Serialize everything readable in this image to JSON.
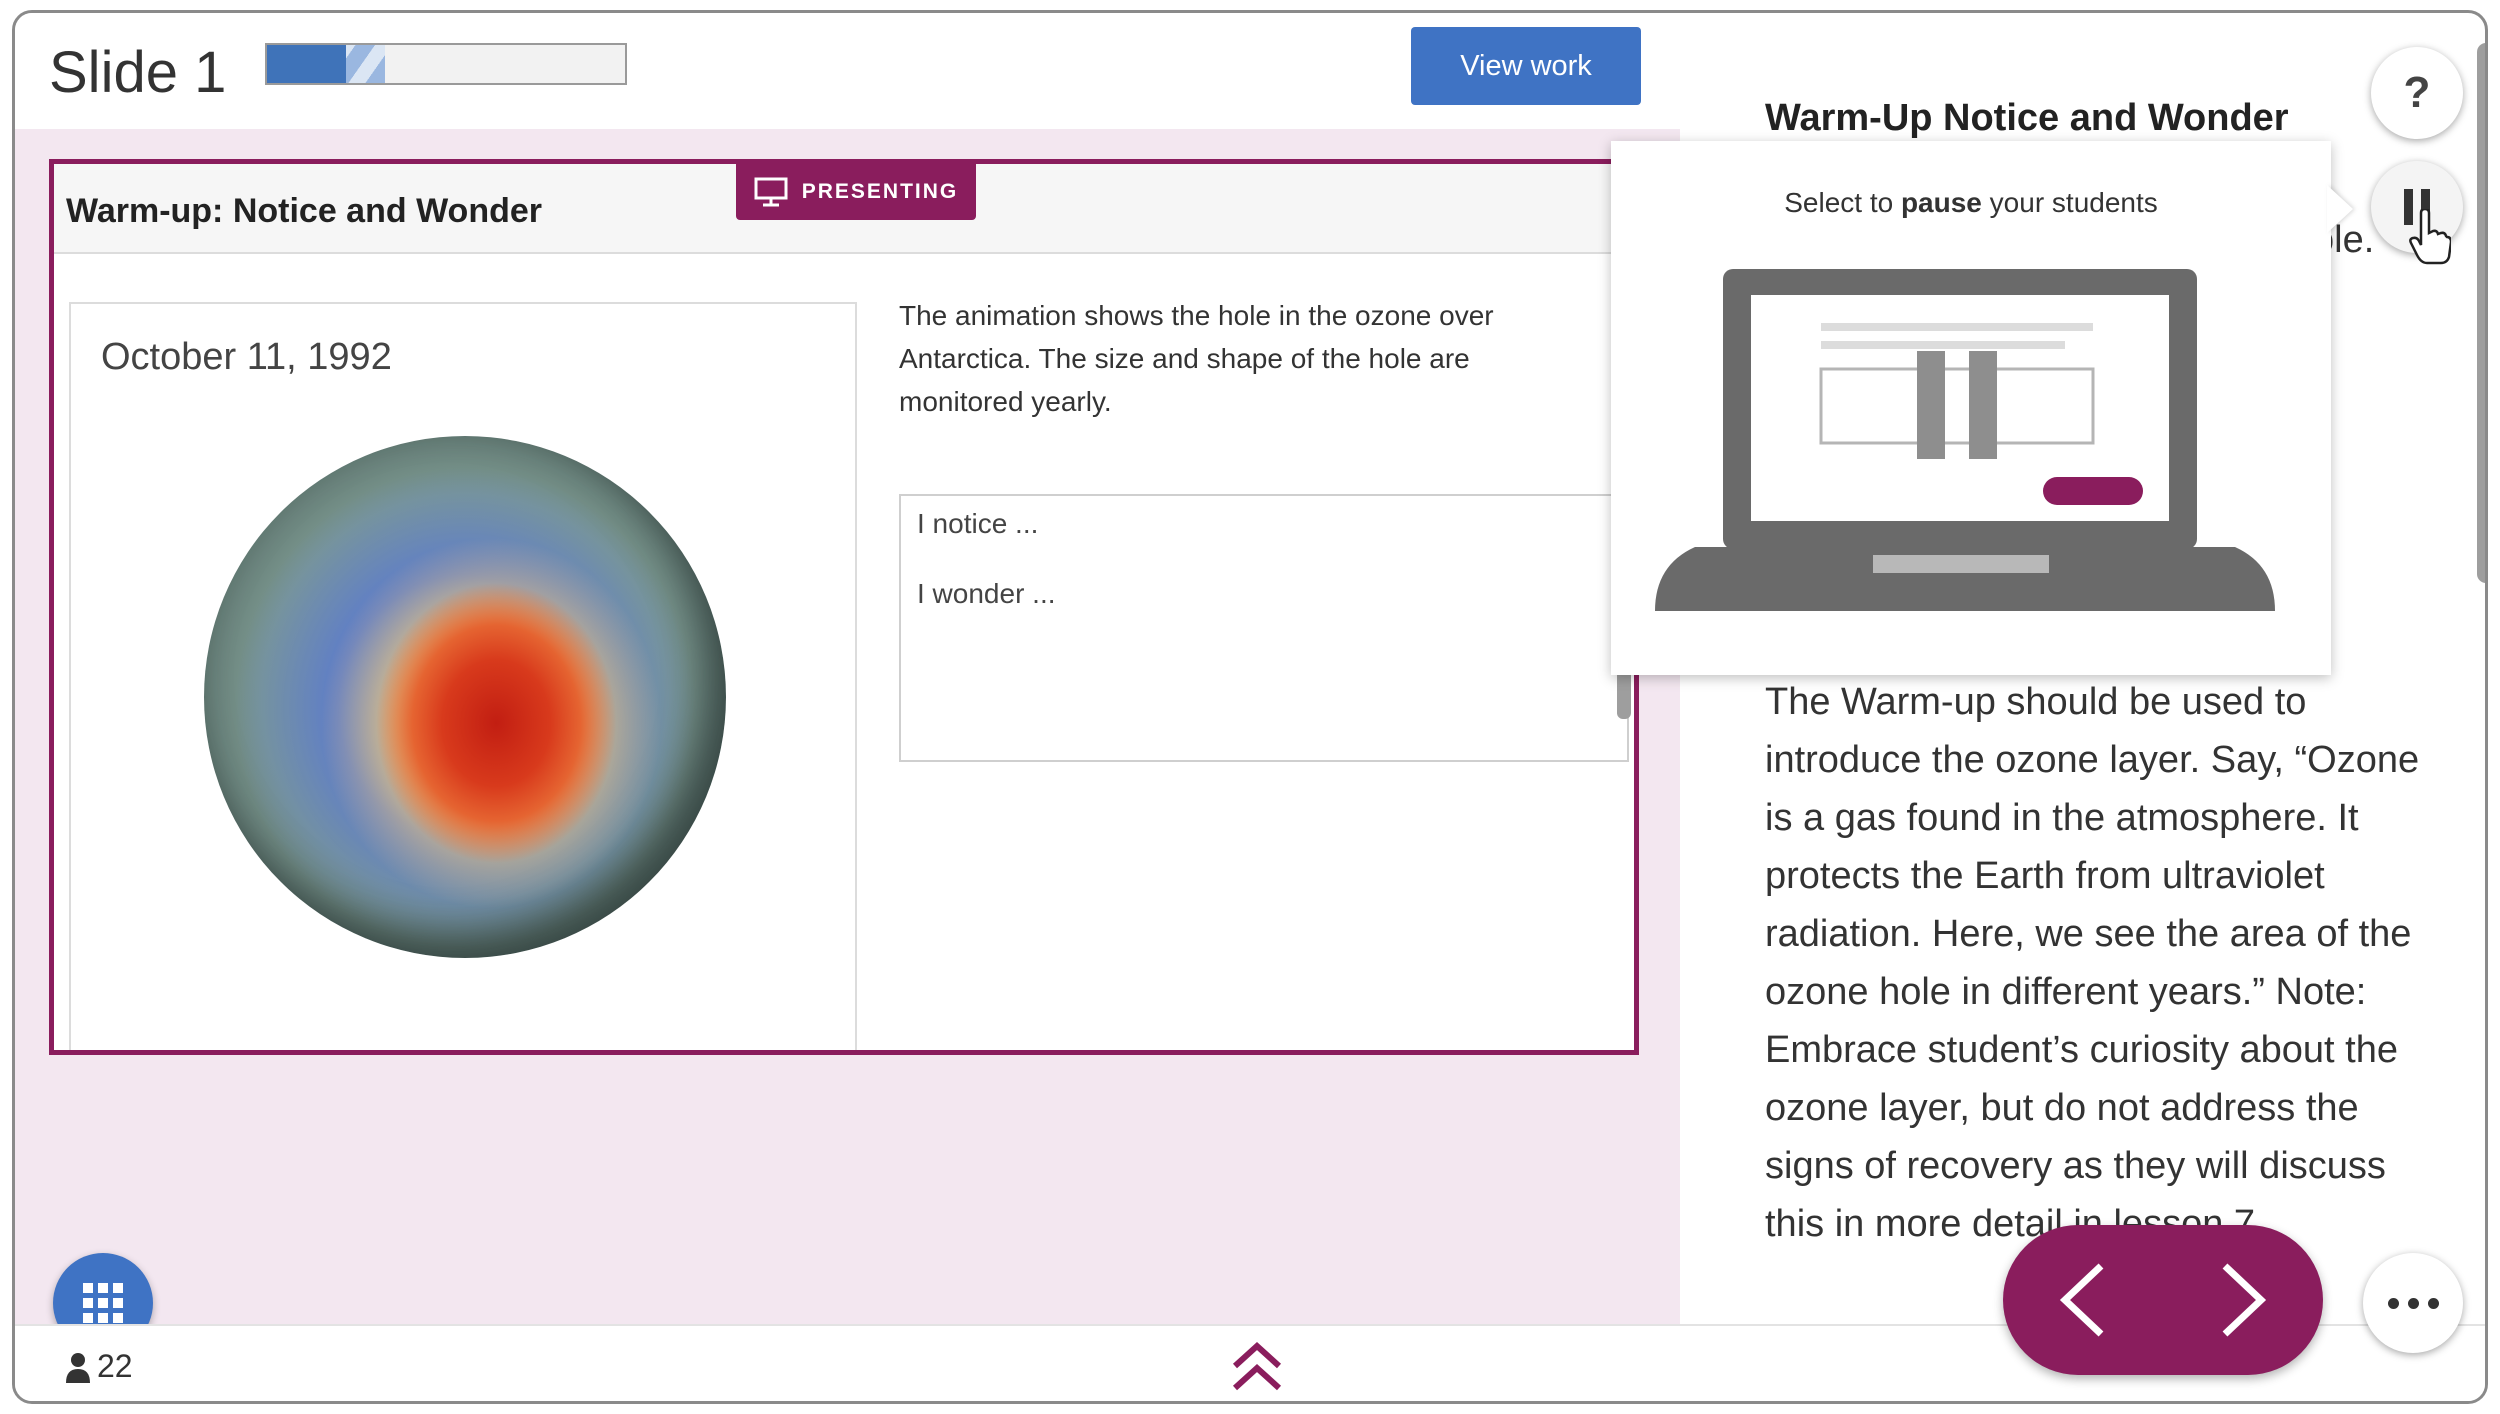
{
  "header": {
    "slide_title": "Slide 1",
    "progress": {
      "complete": 0.22,
      "partial": 0.33
    },
    "view_work_label": "View work"
  },
  "slide": {
    "title": "Warm-up: Notice and Wonder",
    "presenting_label": "PRESENTING",
    "media_date": "October 11, 1992",
    "prompt": "The animation shows the hole in the ozone over Antarctica. The size and shape of the hole are monitored yearly.",
    "answer_line1": "I notice ...",
    "answer_line2": "I wonder ..."
  },
  "panel": {
    "title": "Warm-Up Notice and Wonder",
    "fragment": "ole.",
    "notes": "The Warm-up should be used to introduce the ozone layer. Say, “Ozone is a gas found in the atmosphere. It protects the Earth from ultraviolet radiation. Here, we see the area of the ozone hole in different years.” Note: Embrace student’s curiosity about the ozone layer, but do not address the signs of recovery as they will discuss this in more detail in lesson 7."
  },
  "popover": {
    "msg_pre": "Select to ",
    "msg_bold": "pause",
    "msg_post": " your students"
  },
  "footer": {
    "student_count": "22"
  },
  "help_label": "?",
  "colors": {
    "brand_plum": "#8a1d5d",
    "brand_blue": "#3f73c4",
    "stage_bg": "#f3e7f0"
  },
  "icons": [
    "presenter-screen-icon",
    "grid-icon",
    "person-icon",
    "double-chevron-up-icon",
    "pause-icon",
    "pointer-cursor-icon",
    "chevron-left-icon",
    "chevron-right-icon",
    "ellipsis-icon",
    "laptop-illustration"
  ]
}
